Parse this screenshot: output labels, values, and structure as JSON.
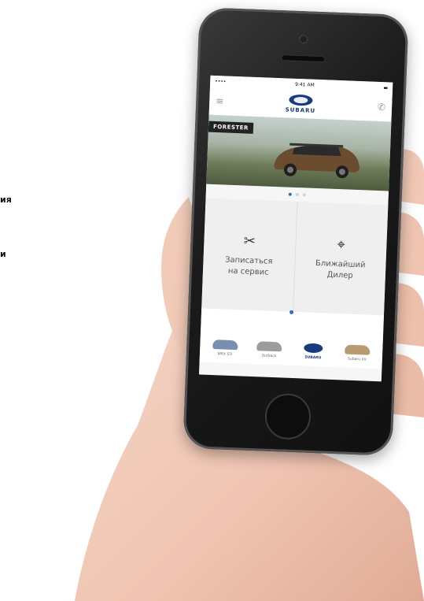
{
  "side_text": [
    "ия",
    "и"
  ],
  "statusbar": {
    "left": "•••• ",
    "center": "9:41 AM",
    "right": "▬"
  },
  "app": {
    "brand": "SUBARU"
  },
  "banner": {
    "label": "FORESTER"
  },
  "actions": [
    {
      "icon": "tools-icon",
      "label_line1": "Записаться",
      "label_line2": "на сервис"
    },
    {
      "icon": "location-pin-icon",
      "label_line1": "Ближайший",
      "label_line2": "Дилер"
    }
  ],
  "models": [
    {
      "label": "WRX STI",
      "color": "#7a8fb0"
    },
    {
      "label": "Outback",
      "color": "#9c9c9c"
    },
    {
      "label": "SUBARU",
      "color": "#1a3a80"
    },
    {
      "label": "Subaru XV",
      "color": "#b89a72"
    }
  ]
}
